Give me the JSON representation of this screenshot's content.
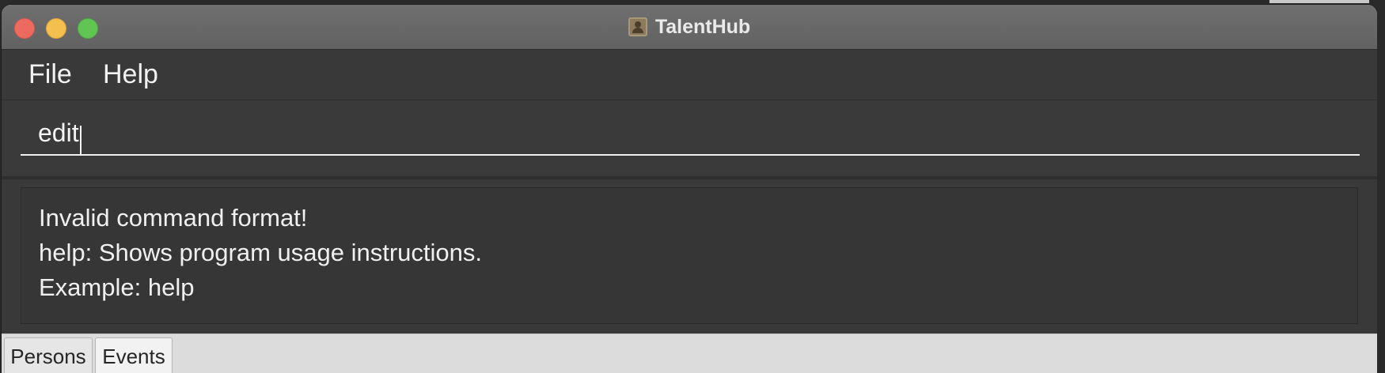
{
  "window": {
    "title": "TalentHub"
  },
  "menu": {
    "items": [
      {
        "label": "File"
      },
      {
        "label": "Help"
      }
    ]
  },
  "command": {
    "value": "edit",
    "placeholder": ""
  },
  "result": {
    "lines": [
      "Invalid command format!",
      "help: Shows program usage instructions.",
      "Example: help"
    ]
  },
  "tabs": [
    {
      "label": "Persons",
      "selected": false
    },
    {
      "label": "Events",
      "selected": true
    }
  ],
  "colors": {
    "close": "#ed6a5e",
    "minimize": "#f5bf4f",
    "maximize": "#61c554",
    "panel_bg": "#393939",
    "text": "#f0f0f0"
  }
}
